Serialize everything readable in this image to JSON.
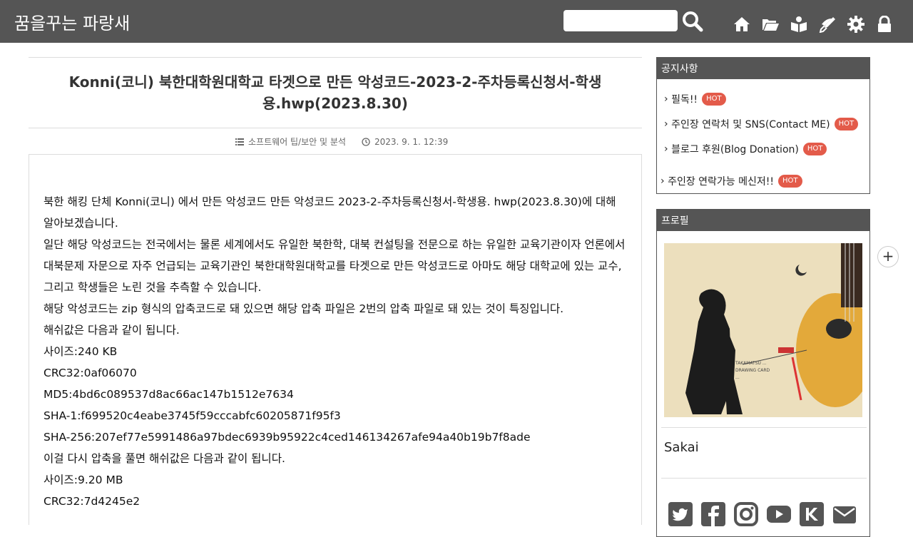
{
  "header": {
    "site_title": "꿈을꾸는 파랑새",
    "search": {
      "value": "",
      "placeholder": ""
    },
    "nav_icons": [
      "home-icon",
      "folder-icon",
      "guestbook-icon",
      "write-icon",
      "gear-icon",
      "lock-icon"
    ]
  },
  "post": {
    "title": "Konni(코니) 북한대학원대학교 타겟으로 만든 악성코드-2023-2-주차등록신청서-학생용.hwp(2023.8.30)",
    "category": "소프트웨어 팁/보안 및 분석",
    "date": "2023. 9. 1. 12:39",
    "paragraphs": [
      "북한 해킹 단체 Konni(코니) 에서 만든 악성코드 만든 악성코드 2023-2-주차등록신청서-학생용. hwp(2023.8.30)에 대해 알아보겠습니다.",
      "일단 해당 악성코드는 전국에서는 물론 세계에서도 유일한 북한학, 대북 컨설팅을 전문으로 하는 유일한 교육기관이자 언론에서 대북문제 자문으로 자주 언급되는 교육기관인 북한대학원대학교를 타겟으로 만든 악성코드로 아마도 해당 대학교에 있는 교수, 그리고 학생들은 노린 것을 추측할 수 있습니다.",
      "해당 악성코드는 zip 형식의 압축코드로 돼 있으면 해당 압축 파일은 2번의 압축 파일로 돼 있는 것이 특징입니다.",
      "해쉬값은 다음과 같이 됩니다.",
      "사이즈:240 KB",
      "CRC32:0af06070",
      "MD5:4bd6c089537d8ac66ac147b1512e7634",
      "SHA-1:f699520c4eabe3745f59cccabfc60205871f95f3",
      "SHA-256:207ef77e5991486a97bdec6939b95922c4ced146134267afe94a40b19b7f8ade",
      "이걸 다시 압축을 풀면 해쉬값은 다음과 같이 됩니다.",
      "사이즈:9.20 MB",
      "CRC32:7d4245e2"
    ]
  },
  "sidebar": {
    "notice": {
      "title": "공지사항",
      "items": [
        {
          "label": "필독!!",
          "badge": "HOT"
        },
        {
          "label": "주인장 연락처 및 SNS(Contact ME)",
          "badge": "HOT"
        },
        {
          "label": "블로그 후원(Blog Donation)",
          "badge": "HOT"
        },
        {
          "label": "주인장 연락가능 메신저!!",
          "badge": "HOT"
        }
      ]
    },
    "profile": {
      "title": "프로필",
      "name": "Sakai",
      "social_icons": [
        "twitter-icon",
        "facebook-icon",
        "instagram-icon",
        "youtube-icon",
        "vk-icon",
        "email-icon"
      ]
    }
  },
  "floating": {
    "plus": "+"
  },
  "colors": {
    "header_bg": "#555555",
    "hot_badge": "#e35b4a",
    "border": "#dcdcdc"
  }
}
